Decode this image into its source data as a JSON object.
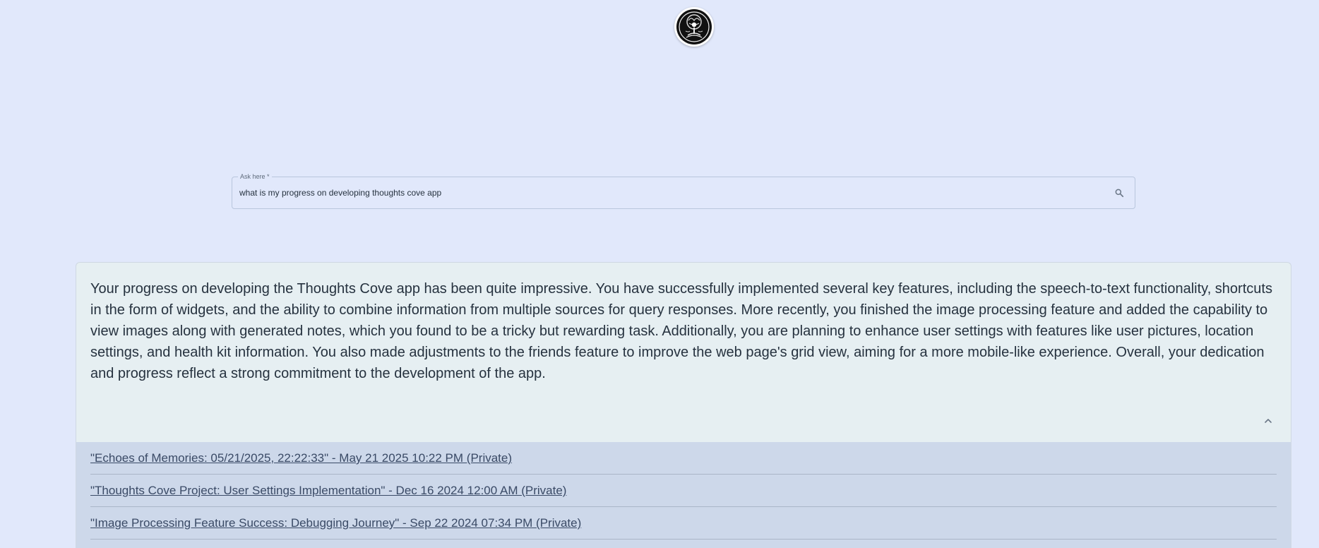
{
  "logo": {
    "icon": "brain-tree-logo-icon"
  },
  "search": {
    "label": "Ask here *",
    "value": "what is my progress on developing thoughts cove app",
    "icon": "search-icon"
  },
  "answer": {
    "text": "Your progress on developing the Thoughts Cove app has been quite impressive. You have successfully implemented several key features, including the speech-to-text functionality, shortcuts in the form of widgets, and the ability to combine information from multiple sources for query responses. More recently, you finished the image processing feature and added the capability to view images along with generated notes, which you found to be a tricky but rewarding task. Additionally, you are planning to enhance user settings with features like user pictures, location settings, and health kit information. You also made adjustments to the friends feature to improve the web page's grid view, aiming for a more mobile-like experience. Overall, your dedication and progress reflect a strong commitment to the development of the app.",
    "collapse_icon": "chevron-up-icon"
  },
  "sources": [
    {
      "label": "\"Echoes of Memories: 05/21/2025, 22:22:33\" - May 21 2025 10:22 PM (Private)"
    },
    {
      "label": "\"Thoughts Cove Project: User Settings Implementation\" - Dec 16 2024 12:00 AM (Private)"
    },
    {
      "label": "\"Image Processing Feature Success: Debugging Journey\" - Sep 22 2024 07:34 PM (Private)"
    }
  ],
  "colors": {
    "background": "#e1e8fb",
    "answer_panel": "#e6eff2",
    "sources_panel": "#cdd8ea",
    "link": "#3a4a66"
  }
}
